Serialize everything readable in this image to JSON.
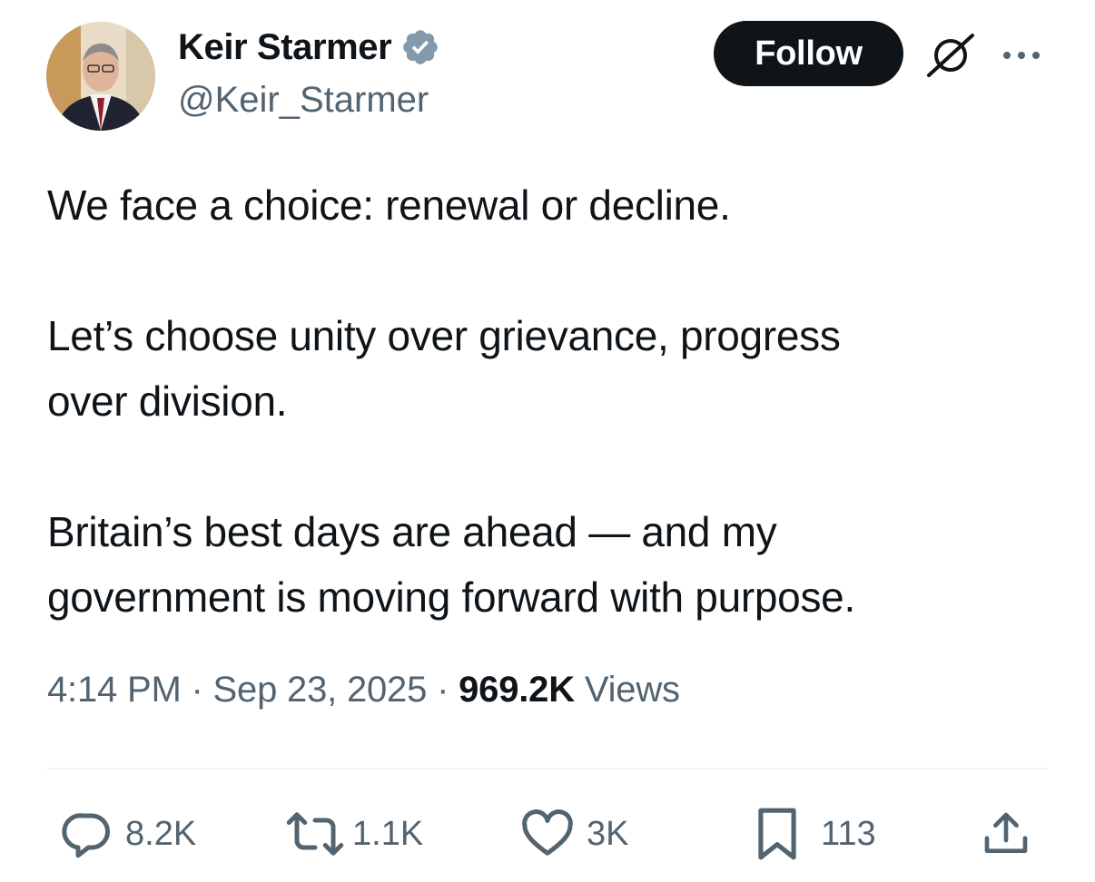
{
  "author": {
    "display_name": "Keir Starmer",
    "handle": "@Keir_Starmer",
    "verified": true
  },
  "header_actions": {
    "follow_label": "Follow",
    "grok_icon": "grok-icon",
    "more_icon": "more-options-icon"
  },
  "tweet": {
    "paragraphs": [
      [
        "We face a choice: renewal or decline."
      ],
      [
        "Let’s choose unity over grievance, progress",
        "over division."
      ],
      [
        "Britain’s best days are ahead — and my",
        "government is moving forward with purpose."
      ]
    ],
    "time": "4:14 PM",
    "separator": "·",
    "date": "Sep 23, 2025",
    "views_count": "969.2K",
    "views_label": "Views"
  },
  "actions": {
    "replies": {
      "icon": "reply-icon",
      "count": "8.2K"
    },
    "reposts": {
      "icon": "repost-icon",
      "count": "1.1K"
    },
    "likes": {
      "icon": "heart-icon",
      "count": "3K"
    },
    "bookmarks": {
      "icon": "bookmark-icon",
      "count": "113"
    },
    "share": {
      "icon": "share-icon"
    }
  },
  "colors": {
    "text_primary": "#0f1419",
    "text_secondary": "#536471",
    "follow_bg": "#0f1419",
    "follow_text": "#ffffff",
    "verified_badge": "#829aab",
    "divider": "#eff3f4"
  }
}
